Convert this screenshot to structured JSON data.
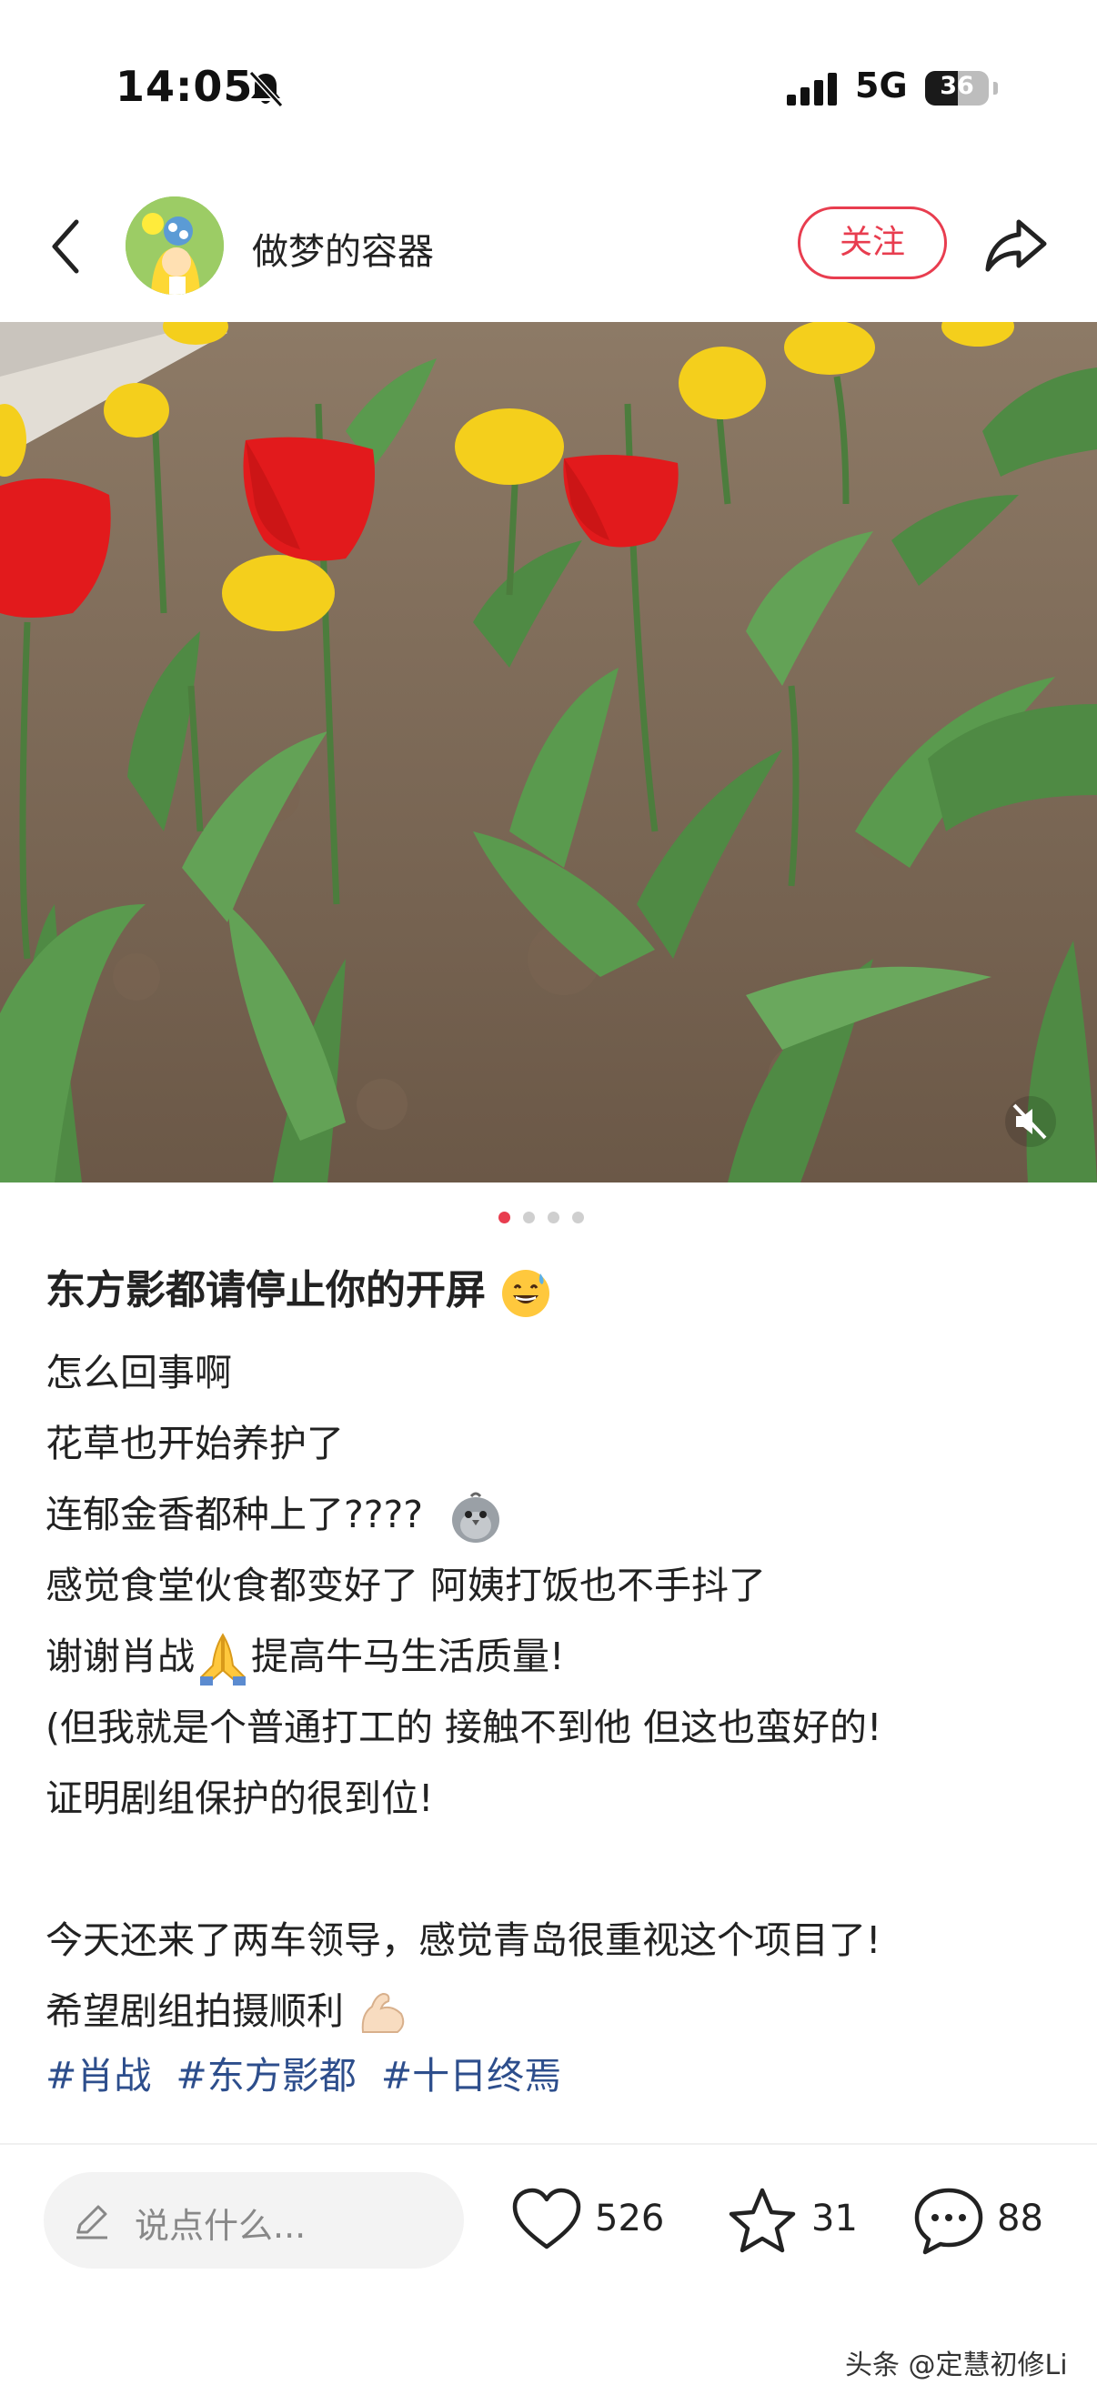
{
  "status_bar": {
    "time": "14:05",
    "network": "5G",
    "battery": "36"
  },
  "header": {
    "username": "做梦的容器",
    "follow_label": "关注"
  },
  "carousel": {
    "pages": 4,
    "active": 0
  },
  "post": {
    "title": "东方影都请停止你的开屏",
    "lines": [
      "怎么回事啊",
      "花草也开始养护了",
      "连郁金香都种上了????",
      "感觉食堂伙食都变好了 阿姨打饭也不手抖了",
      "谢谢肖战",
      "提高牛马生活质量!",
      "(但我就是个普通打工的 接触不到他 但这也蛮好的!",
      "证明剧组保护的很到位!",
      "今天还来了两车领导，感觉青岛很重视这个项目了!",
      "希望剧组拍摄顺利"
    ],
    "tags": [
      "#肖战",
      "#东方影都",
      "#十日终焉"
    ]
  },
  "bottom_bar": {
    "comment_placeholder": "说点什么...",
    "likes": "526",
    "stars": "31",
    "comments": "88"
  },
  "watermark": "头条 @定慧初修Li",
  "colors": {
    "accent": "#e83d4f",
    "tag": "#2d4e8c"
  }
}
